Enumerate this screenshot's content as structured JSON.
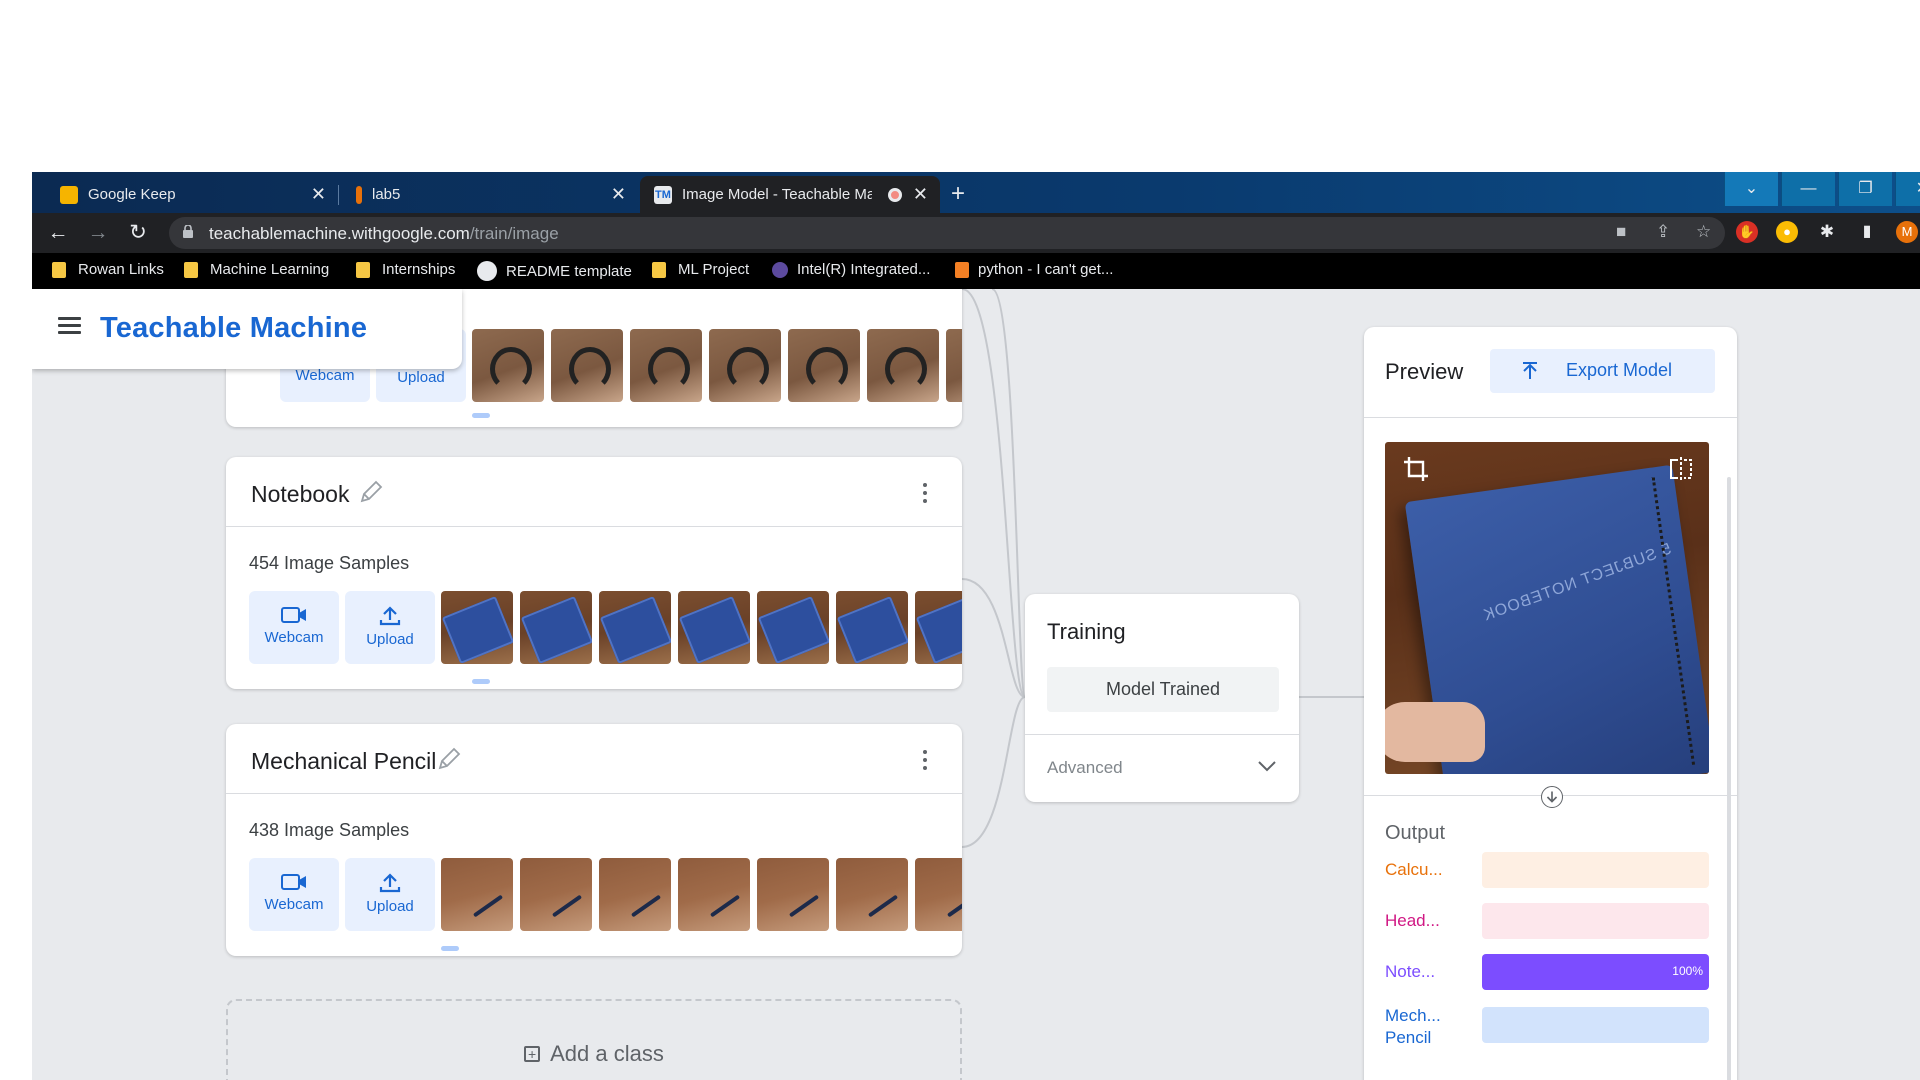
{
  "browser": {
    "tabs": [
      {
        "title": "Google Keep"
      },
      {
        "title": "lab5"
      },
      {
        "title": "Image Model - Teachable Ma"
      }
    ],
    "url": {
      "host": "teachablemachine.withgoogle.com",
      "path": "/train/image"
    },
    "bookmarks": [
      {
        "label": "Rowan Links"
      },
      {
        "label": "Machine Learning"
      },
      {
        "label": "Internships"
      },
      {
        "label": "README template"
      },
      {
        "label": "ML Project"
      },
      {
        "label": "Intel(R) Integrated..."
      },
      {
        "label": "python - I can't get..."
      }
    ],
    "profile_initial": "M"
  },
  "app": {
    "brand": "Teachable Machine"
  },
  "classes": [
    {
      "name": "",
      "samples": "",
      "webcam_label": "Webcam",
      "upload_label": "Upload",
      "thumb_kind": "headphone",
      "thumb_count": 7
    },
    {
      "name": "Notebook",
      "samples": "454 Image Samples",
      "webcam_label": "Webcam",
      "upload_label": "Upload",
      "thumb_kind": "notebook",
      "thumb_count": 7
    },
    {
      "name": "Mechanical Pencil",
      "samples": "438 Image Samples",
      "webcam_label": "Webcam",
      "upload_label": "Upload",
      "thumb_kind": "pencil",
      "thumb_count": 7
    }
  ],
  "add_class_label": "Add a class",
  "training": {
    "title": "Training",
    "status": "Model Trained",
    "advanced": "Advanced"
  },
  "preview": {
    "title": "Preview",
    "export_label": "Export Model",
    "output_title": "Output",
    "outputs": [
      {
        "label": "Calcu...",
        "label2": "",
        "percent": 0,
        "text": "",
        "color": "#e8710a",
        "track": "#feefe3",
        "fill": "#e8710a"
      },
      {
        "label": "Head...",
        "label2": "",
        "percent": 0,
        "text": "",
        "color": "#d01884",
        "track": "#fde7ec",
        "fill": "#d01884"
      },
      {
        "label": "Note...",
        "label2": "",
        "percent": 100,
        "text": "100%",
        "color": "#7c4dff",
        "track": "#ede7f6",
        "fill": "#7c4dff"
      },
      {
        "label": "Mech...",
        "label2": "Pencil",
        "percent": 0,
        "text": "",
        "color": "#1967d2",
        "track": "#d2e3fc",
        "fill": "#1967d2"
      }
    ]
  },
  "colors": {
    "accent": "#1967d2",
    "chrome_dark": "#202124"
  }
}
